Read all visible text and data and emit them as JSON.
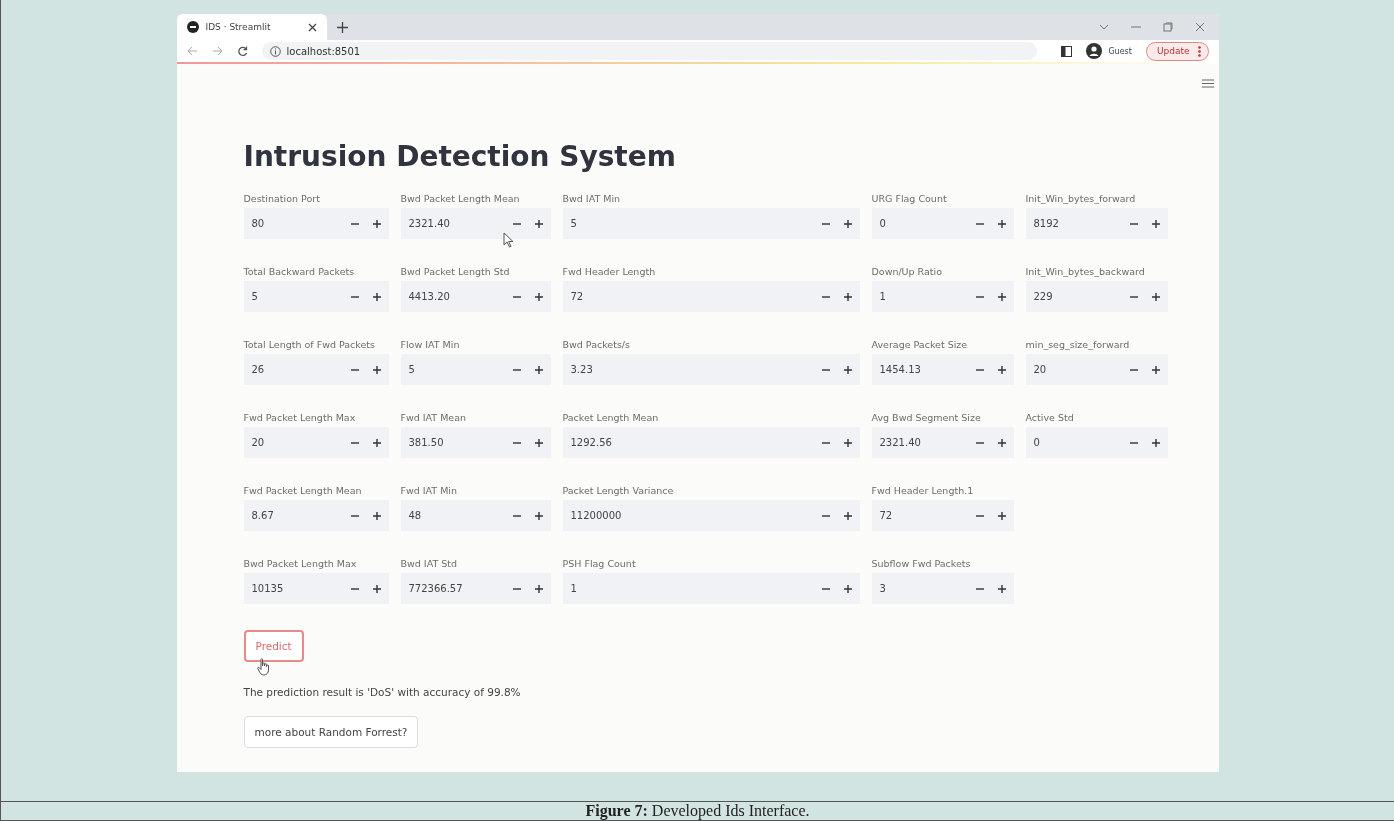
{
  "browser": {
    "tab": {
      "title": "IDS · Streamlit",
      "selected": true
    },
    "address": "localhost:8501",
    "profile": "Guest",
    "update_button": "Update"
  },
  "page": {
    "title": "Intrusion Detection System",
    "columns": [
      [
        {
          "label": "Destination Port",
          "value": "80"
        },
        {
          "label": "Total Backward Packets",
          "value": "5"
        },
        {
          "label": "Total Length of Fwd Packets",
          "value": "26"
        },
        {
          "label": "Fwd Packet Length Max",
          "value": "20"
        },
        {
          "label": "Fwd Packet Length Mean",
          "value": "8.67"
        },
        {
          "label": "Bwd Packet Length Max",
          "value": "10135"
        }
      ],
      [
        {
          "label": "Bwd Packet Length Mean",
          "value": "2321.40"
        },
        {
          "label": "Bwd Packet Length Std",
          "value": "4413.20"
        },
        {
          "label": "Flow IAT Min",
          "value": "5"
        },
        {
          "label": "Fwd IAT Mean",
          "value": "381.50"
        },
        {
          "label": "Fwd IAT Min",
          "value": "48"
        },
        {
          "label": "Bwd IAT Std",
          "value": "772366.57"
        }
      ],
      [
        {
          "label": "Bwd IAT Min",
          "value": "5"
        },
        {
          "label": "Fwd Header Length",
          "value": "72"
        },
        {
          "label": "Bwd Packets/s",
          "value": "3.23"
        },
        {
          "label": "Packet Length Mean",
          "value": "1292.56"
        },
        {
          "label": "Packet Length Variance",
          "value": "11200000"
        },
        {
          "label": "PSH Flag Count",
          "value": "1"
        }
      ],
      [
        {
          "label": "URG Flag Count",
          "value": "0"
        },
        {
          "label": "Down/Up Ratio",
          "value": "1"
        },
        {
          "label": "Average Packet Size",
          "value": "1454.13"
        },
        {
          "label": "Avg Bwd Segment Size",
          "value": "2321.40"
        },
        {
          "label": "Fwd Header Length.1",
          "value": "72"
        },
        {
          "label": "Subflow Fwd Packets",
          "value": "3"
        }
      ],
      [
        {
          "label": "Init_Win_bytes_forward",
          "value": "8192"
        },
        {
          "label": "Init_Win_bytes_backward",
          "value": "229"
        },
        {
          "label": "min_seg_size_forward",
          "value": "20"
        },
        {
          "label": "Active Std",
          "value": "0"
        }
      ]
    ],
    "predict_button": {
      "label": "Predict",
      "focused": true
    },
    "result": "The prediction result is 'DoS' with accuracy of 99.8%",
    "more_button": "more about Random Forrest?"
  },
  "caption": "**Figure 7:** Developed Ids Interface."
}
